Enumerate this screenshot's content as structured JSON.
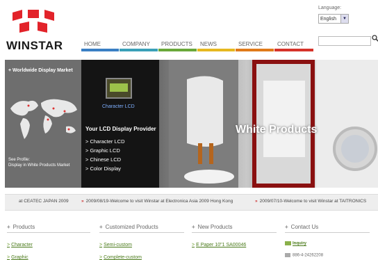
{
  "brand": {
    "name": "WINSTAR",
    "logo_colors": [
      "#e2232a",
      "#e2232a"
    ]
  },
  "language": {
    "label": "Language:",
    "selected": "English"
  },
  "search": {
    "placeholder": ""
  },
  "nav": [
    {
      "label": "HOME",
      "color": "#3a7fc4"
    },
    {
      "label": "COMPANY",
      "color": "#3aa0b8"
    },
    {
      "label": "PRODUCTS",
      "color": "#6aa83a"
    },
    {
      "label": "NEWS",
      "color": "#e6b820"
    },
    {
      "label": "SERVICE",
      "color": "#e07a1a"
    },
    {
      "label": "CONTACT",
      "color": "#d6332a"
    }
  ],
  "banner": {
    "market_title": "+ Worldwide Display Market",
    "market_caption_line1": "See Profile:",
    "market_caption_line2": "Display in White Products Market",
    "lcd_caption": "Character LCD",
    "lcd_title": "Your LCD Display Provider",
    "lcd_items": [
      "> Character LCD",
      "> Graphic LCD",
      "> Chinese LCD",
      "> Color Display"
    ],
    "products_title": "White Products"
  },
  "news": [
    {
      "text": "at CEATEC JAPAN 2009",
      "chevron": ""
    },
    {
      "text": "2009/08/19-Welcome to visit Winstar at Electronica Asia 2009 Hong Kong",
      "chevron": "»"
    },
    {
      "text": "2009/07/10-Welcome to visit Winstar at TAITRONICS",
      "chevron": "»"
    }
  ],
  "sections": {
    "products": {
      "title": "Products",
      "links": [
        "Character",
        "Graphic"
      ]
    },
    "customized": {
      "title": "Customized Products",
      "links": [
        "Semi-custom",
        "Complete-custom"
      ]
    },
    "new_products": {
      "title": "New Products",
      "links": [
        "E Paper 10\"1 SA00046"
      ]
    },
    "contact": {
      "title": "Contact Us",
      "email": "Inquiry",
      "phone": "886-4-24262208"
    }
  }
}
